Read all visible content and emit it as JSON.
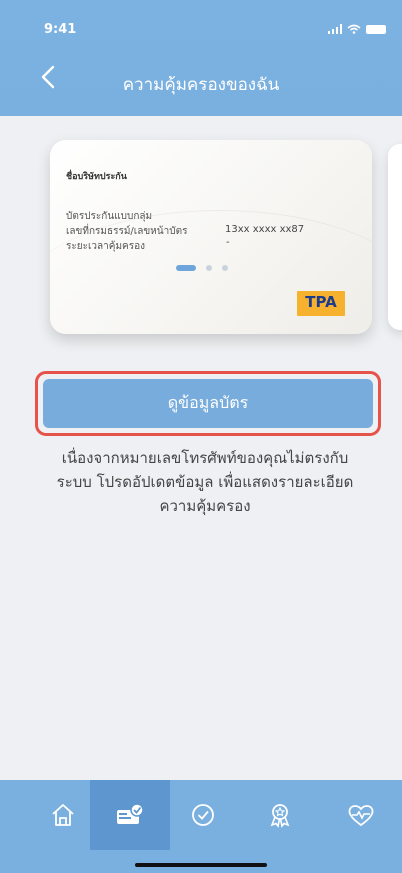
{
  "status": {
    "time": "9:41"
  },
  "header": {
    "title": "ความคุ้มครองของฉัน"
  },
  "card": {
    "company_name": "ชื่อบริษัทประกัน",
    "line1": "บัตรประกันแบบกลุ่ม",
    "line2": "เลขที่กรมธรรม์/เลขหน้าบัตร",
    "line3": "ระยะเวลาคุ้มครอง",
    "id_value": "13xx xxxx xx87",
    "period_value": "-",
    "badge": "TPA"
  },
  "pager": {
    "count": 3,
    "active": 0
  },
  "actions": {
    "view_card_label": "ดูข้อมูลบัตร"
  },
  "message": {
    "line1": "เนื่องจากหมายเลขโทรศัพท์ของคุณไม่ตรงกับ",
    "line2": "ระบบ โปรดอัปเดตข้อมูล เพื่อแสดงรายละเอียด",
    "line3": "ความคุ้มครอง"
  },
  "tabbar": {
    "items": [
      {
        "icon": "home-icon"
      },
      {
        "icon": "coverage-card-icon",
        "active": true
      },
      {
        "icon": "check-circle-icon"
      },
      {
        "icon": "award-icon"
      },
      {
        "icon": "heart-pulse-icon"
      }
    ]
  },
  "colors": {
    "header": "#7ab0df",
    "accent": "#6ea5da",
    "highlight": "#e5534b",
    "badge": "#f6b12e"
  }
}
